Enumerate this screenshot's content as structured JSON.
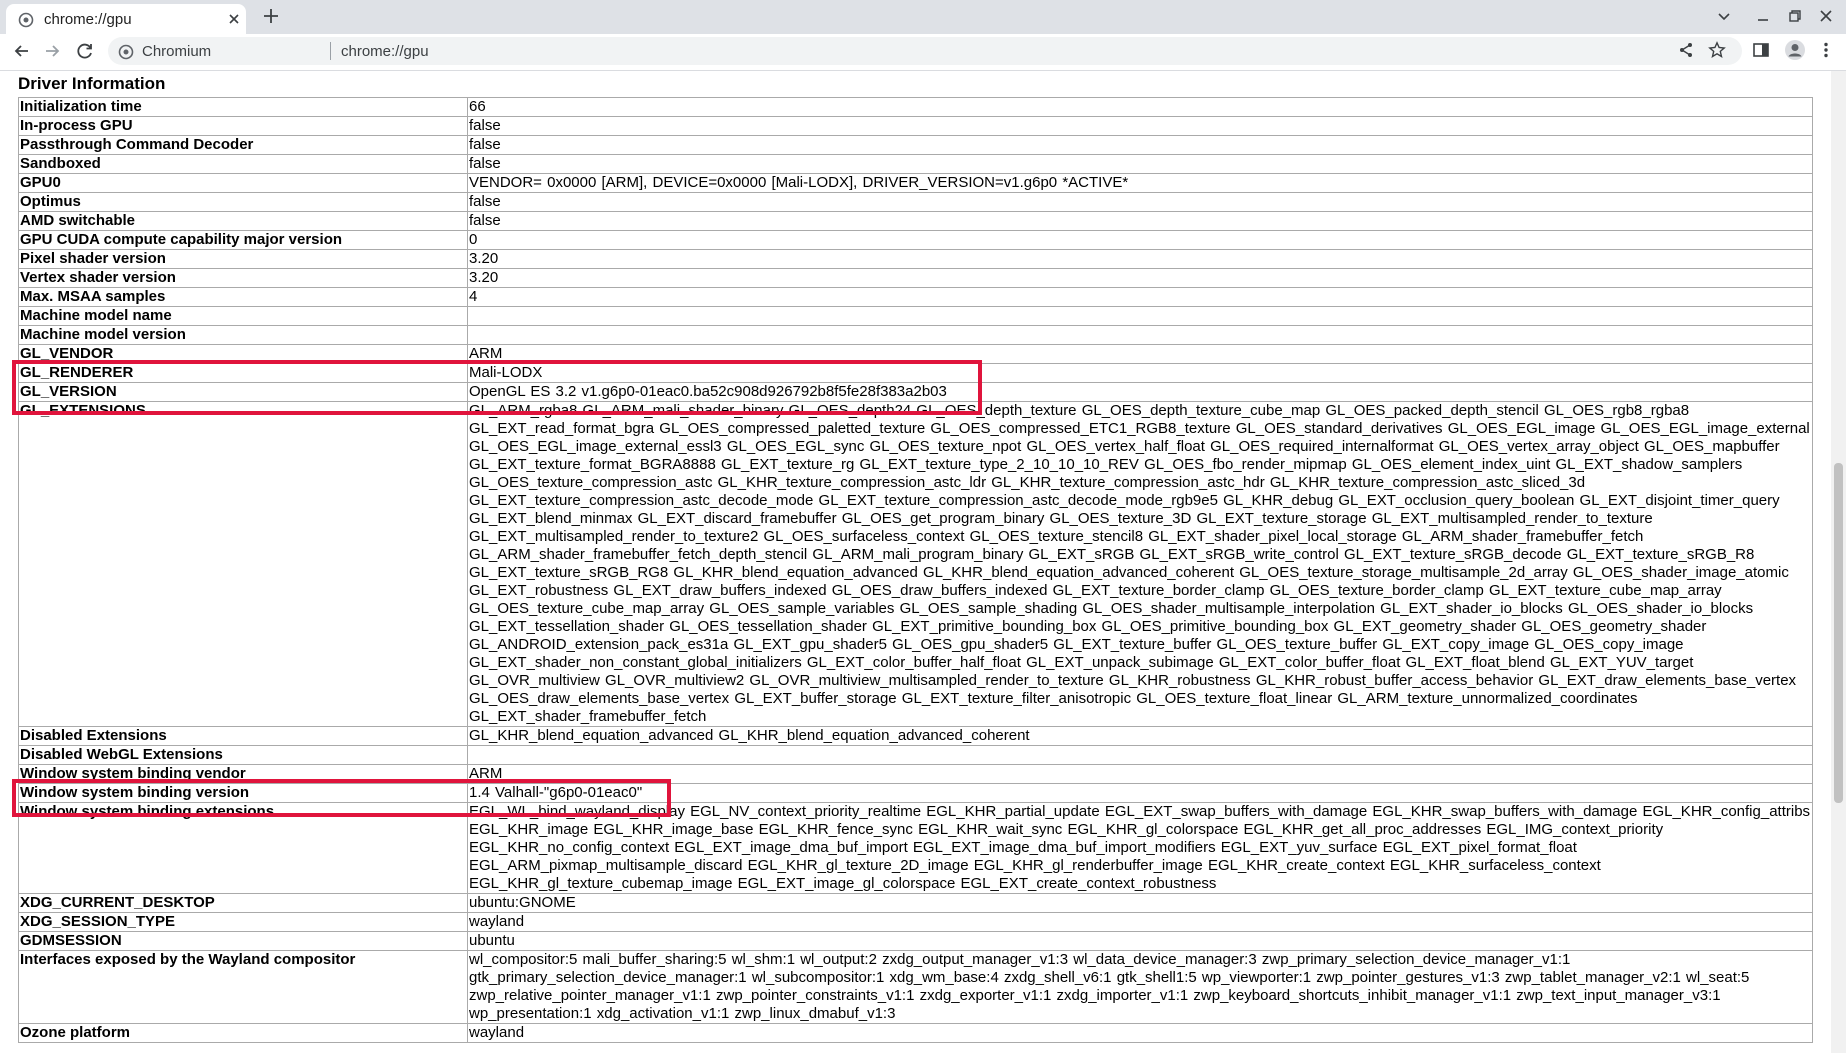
{
  "browser": {
    "tab_title": "chrome://gpu",
    "omnibox_label": "Chromium",
    "url": "chrome://gpu"
  },
  "section_title": "Driver Information",
  "rows": [
    {
      "key": "Initialization time",
      "value": "66"
    },
    {
      "key": "In-process GPU",
      "value": "false"
    },
    {
      "key": "Passthrough Command Decoder",
      "value": "false"
    },
    {
      "key": "Sandboxed",
      "value": "false"
    },
    {
      "key": "GPU0",
      "value": "VENDOR= 0x0000 [ARM], DEVICE=0x0000 [Mali-LODX], DRIVER_VERSION=v1.g6p0 *ACTIVE*"
    },
    {
      "key": "Optimus",
      "value": "false"
    },
    {
      "key": "AMD switchable",
      "value": "false"
    },
    {
      "key": "GPU CUDA compute capability major version",
      "value": "0"
    },
    {
      "key": "Pixel shader version",
      "value": "3.20"
    },
    {
      "key": "Vertex shader version",
      "value": "3.20"
    },
    {
      "key": "Max. MSAA samples",
      "value": "4"
    },
    {
      "key": "Machine model name",
      "value": ""
    },
    {
      "key": "Machine model version",
      "value": ""
    },
    {
      "key": "GL_VENDOR",
      "value": "ARM"
    },
    {
      "key": "GL_RENDERER",
      "value": "Mali-LODX"
    },
    {
      "key": "GL_VERSION",
      "value": "OpenGL ES 3.2 v1.g6p0-01eac0.ba52c908d926792b8f5fe28f383a2b03"
    },
    {
      "key": "GL_EXTENSIONS",
      "value": "GL_ARM_rgba8 GL_ARM_mali_shader_binary GL_OES_depth24 GL_OES_depth_texture GL_OES_depth_texture_cube_map GL_OES_packed_depth_stencil GL_OES_rgb8_rgba8 GL_EXT_read_format_bgra GL_OES_compressed_paletted_texture GL_OES_compressed_ETC1_RGB8_texture GL_OES_standard_derivatives GL_OES_EGL_image GL_OES_EGL_image_external GL_OES_EGL_image_external_essl3 GL_OES_EGL_sync GL_OES_texture_npot GL_OES_vertex_half_float GL_OES_required_internalformat GL_OES_vertex_array_object GL_OES_mapbuffer GL_EXT_texture_format_BGRA8888 GL_EXT_texture_rg GL_EXT_texture_type_2_10_10_10_REV GL_OES_fbo_render_mipmap GL_OES_element_index_uint GL_EXT_shadow_samplers GL_OES_texture_compression_astc GL_KHR_texture_compression_astc_ldr GL_KHR_texture_compression_astc_hdr GL_KHR_texture_compression_astc_sliced_3d GL_EXT_texture_compression_astc_decode_mode GL_EXT_texture_compression_astc_decode_mode_rgb9e5 GL_KHR_debug GL_EXT_occlusion_query_boolean GL_EXT_disjoint_timer_query GL_EXT_blend_minmax GL_EXT_discard_framebuffer GL_OES_get_program_binary GL_OES_texture_3D GL_EXT_texture_storage GL_EXT_multisampled_render_to_texture GL_EXT_multisampled_render_to_texture2 GL_OES_surfaceless_context GL_OES_texture_stencil8 GL_EXT_shader_pixel_local_storage GL_ARM_shader_framebuffer_fetch GL_ARM_shader_framebuffer_fetch_depth_stencil GL_ARM_mali_program_binary GL_EXT_sRGB GL_EXT_sRGB_write_control GL_EXT_texture_sRGB_decode GL_EXT_texture_sRGB_R8 GL_EXT_texture_sRGB_RG8 GL_KHR_blend_equation_advanced GL_KHR_blend_equation_advanced_coherent GL_OES_texture_storage_multisample_2d_array GL_OES_shader_image_atomic GL_EXT_robustness GL_EXT_draw_buffers_indexed GL_OES_draw_buffers_indexed GL_EXT_texture_border_clamp GL_OES_texture_border_clamp GL_EXT_texture_cube_map_array GL_OES_texture_cube_map_array GL_OES_sample_variables GL_OES_sample_shading GL_OES_shader_multisample_interpolation GL_EXT_shader_io_blocks GL_OES_shader_io_blocks GL_EXT_tessellation_shader GL_OES_tessellation_shader GL_EXT_primitive_bounding_box GL_OES_primitive_bounding_box GL_EXT_geometry_shader GL_OES_geometry_shader GL_ANDROID_extension_pack_es31a GL_EXT_gpu_shader5 GL_OES_gpu_shader5 GL_EXT_texture_buffer GL_OES_texture_buffer GL_EXT_copy_image GL_OES_copy_image GL_EXT_shader_non_constant_global_initializers GL_EXT_color_buffer_half_float GL_EXT_unpack_subimage GL_EXT_color_buffer_float GL_EXT_float_blend GL_EXT_YUV_target GL_OVR_multiview GL_OVR_multiview2 GL_OVR_multiview_multisampled_render_to_texture GL_KHR_robustness GL_KHR_robust_buffer_access_behavior GL_EXT_draw_elements_base_vertex GL_OES_draw_elements_base_vertex GL_EXT_buffer_storage GL_EXT_texture_filter_anisotropic GL_OES_texture_float_linear GL_ARM_texture_unnormalized_coordinates GL_EXT_shader_framebuffer_fetch"
    },
    {
      "key": "Disabled Extensions",
      "value": "GL_KHR_blend_equation_advanced GL_KHR_blend_equation_advanced_coherent"
    },
    {
      "key": "Disabled WebGL Extensions",
      "value": ""
    },
    {
      "key": "Window system binding vendor",
      "value": "ARM"
    },
    {
      "key": "Window system binding version",
      "value": "1.4 Valhall-\"g6p0-01eac0\""
    },
    {
      "key": "Window system binding extensions",
      "value": "EGL_WL_bind_wayland_display EGL_NV_context_priority_realtime EGL_KHR_partial_update EGL_EXT_swap_buffers_with_damage EGL_KHR_swap_buffers_with_damage EGL_KHR_config_attribs EGL_KHR_image EGL_KHR_image_base EGL_KHR_fence_sync EGL_KHR_wait_sync EGL_KHR_gl_colorspace EGL_KHR_get_all_proc_addresses EGL_IMG_context_priority EGL_KHR_no_config_context EGL_EXT_image_dma_buf_import EGL_EXT_image_dma_buf_import_modifiers EGL_EXT_yuv_surface EGL_EXT_pixel_format_float EGL_ARM_pixmap_multisample_discard EGL_KHR_gl_texture_2D_image EGL_KHR_gl_renderbuffer_image EGL_KHR_create_context EGL_KHR_surfaceless_context EGL_KHR_gl_texture_cubemap_image EGL_EXT_image_gl_colorspace EGL_EXT_create_context_robustness"
    },
    {
      "key": "XDG_CURRENT_DESKTOP",
      "value": "ubuntu:GNOME"
    },
    {
      "key": "XDG_SESSION_TYPE",
      "value": "wayland"
    },
    {
      "key": "GDMSESSION",
      "value": "ubuntu"
    },
    {
      "key": "Interfaces exposed by the Wayland compositor",
      "value": "wl_compositor:5 mali_buffer_sharing:5 wl_shm:1 wl_output:2 zxdg_output_manager_v1:3 wl_data_device_manager:3 zwp_primary_selection_device_manager_v1:1 gtk_primary_selection_device_manager:1 wl_subcompositor:1 xdg_wm_base:4 zxdg_shell_v6:1 gtk_shell1:5 wp_viewporter:1 zwp_pointer_gestures_v1:3 zwp_tablet_manager_v2:1 wl_seat:5 zwp_relative_pointer_manager_v1:1 zwp_pointer_constraints_v1:1 zxdg_exporter_v1:1 zxdg_importer_v1:1 zwp_keyboard_shortcuts_inhibit_manager_v1:1 zwp_text_input_manager_v3:1 wp_presentation:1 xdg_activation_v1:1 zwp_linux_dmabuf_v1:3"
    },
    {
      "key": "Ozone platform",
      "value": "wayland"
    }
  ],
  "colors": {
    "highlight": "#e0143c",
    "tabbar": "#dee1e6",
    "omnibox": "#f1f3f4"
  },
  "icons": [
    "page-icon",
    "close-icon",
    "plus-icon",
    "chevron-down-icon",
    "minimize-icon",
    "restore-icon",
    "close-window-icon",
    "back-arrow-icon",
    "forward-arrow-icon",
    "reload-icon",
    "site-info-icon",
    "share-icon",
    "star-icon",
    "side-panel-icon",
    "profile-icon",
    "kebab-menu-icon"
  ]
}
